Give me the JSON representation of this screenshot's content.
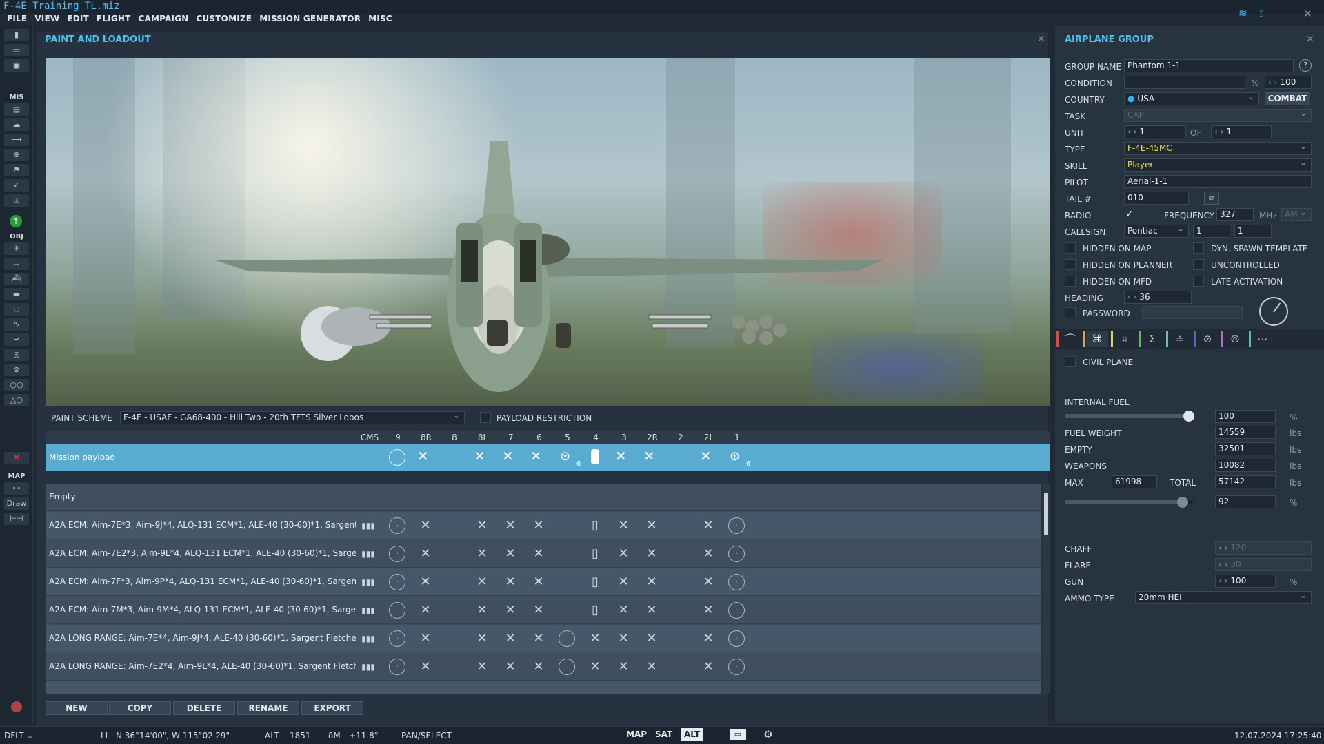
{
  "app": {
    "title": "F-4E Training TL.miz"
  },
  "menu": [
    "FILE",
    "VIEW",
    "EDIT",
    "FLIGHT",
    "CAMPAIGN",
    "CUSTOMIZE",
    "MISSION GENERATOR",
    "MISC"
  ],
  "left_toolbar": {
    "mis_label": "MIS",
    "obj_label": "OBJ",
    "map_label": "MAP",
    "draw_label": "Draw"
  },
  "paint": {
    "title": "PAINT AND LOADOUT",
    "paint_scheme_label": "PAINT SCHEME",
    "paint_scheme_value": "F-4E - USAF - GA68-400 - Hill Two - 20th TFTS Silver Lobos",
    "payload_restriction_label": "PAYLOAD RESTRICTION",
    "columns": [
      "CMS",
      "9",
      "8R",
      "8",
      "8L",
      "7",
      "6",
      "5",
      "4",
      "3",
      "2R",
      "2",
      "2L",
      "1"
    ],
    "mission_payload_label": "Mission payload",
    "mission_payload_counts": {
      "pylon5": "6",
      "pylon1": "6"
    },
    "loadouts": [
      "Empty",
      "A2A ECM: Aim-7E*3, Aim-9J*4, ALQ-131 ECM*1, ALE-40 (30-60)*1, Sargent Fletcher",
      "A2A ECM: Aim-7E2*3, Aim-9L*4, ALQ-131 ECM*1, ALE-40 (30-60)*1, Sargent Fletch",
      "A2A ECM: Aim-7F*3, Aim-9P*4, ALQ-131 ECM*1, ALE-40 (30-60)*1, Sargent Fletche",
      "A2A ECM: Aim-7M*3, Aim-9M*4, ALQ-131 ECM*1, ALE-40 (30-60)*1, Sargent Fletch",
      "A2A LONG RANGE: Aim-7E*4, Aim-9J*4, ALE-40 (30-60)*1, Sargent Fletcher Fuel Ta",
      "A2A LONG RANGE: Aim-7E2*4, Aim-9L*4, ALE-40 (30-60)*1, Sargent Fletcher Fuel T"
    ],
    "buttons": {
      "new": "NEW",
      "copy": "COPY",
      "delete": "DELETE",
      "rename": "RENAME",
      "export": "EXPORT"
    }
  },
  "group": {
    "title": "AIRPLANE GROUP",
    "labels": {
      "group_name": "GROUP NAME",
      "condition": "CONDITION",
      "country": "COUNTRY",
      "task": "TASK",
      "unit": "UNIT",
      "of": "OF",
      "type": "TYPE",
      "skill": "SKILL",
      "pilot": "PILOT",
      "tail": "TAIL #",
      "radio": "RADIO",
      "frequency": "FREQUENCY",
      "callsign": "CALLSIGN",
      "hidden_on_map": "HIDDEN ON MAP",
      "hidden_on_planner": "HIDDEN ON PLANNER",
      "hidden_on_mfd": "HIDDEN ON MFD",
      "dyn_spawn": "DYN. SPAWN TEMPLATE",
      "uncontrolled": "UNCONTROLLED",
      "late_activation": "LATE ACTIVATION",
      "heading": "HEADING",
      "password": "PASSWORD",
      "civil_plane": "CIVIL PLANE"
    },
    "group_name": "Phantom 1-1",
    "condition_pct": "%",
    "condition_value": "100",
    "country": "USA",
    "combat_button": "COMBAT",
    "task": "CAP",
    "unit": "1",
    "unit_of": "1",
    "type": "F-4E-45MC",
    "skill": "Player",
    "pilot": "Aerial-1-1",
    "tail": "010",
    "frequency": "327",
    "freq_unit": "MHz",
    "modulation": "AM",
    "callsign_name": "Pontiac",
    "callsign_1": "1",
    "callsign_2": "1",
    "heading": "36",
    "help": "?"
  },
  "fuel": {
    "labels": {
      "internal_fuel": "INTERNAL FUEL",
      "fuel_weight": "FUEL WEIGHT",
      "empty": "EMPTY",
      "weapons": "WEAPONS",
      "max": "MAX",
      "total": "TOTAL",
      "chaff": "CHAFF",
      "flare": "FLARE",
      "gun": "GUN",
      "ammo_type": "AMMO TYPE"
    },
    "internal_fuel": "100",
    "internal_fuel_level": 0.97,
    "fuel_weight": "14559",
    "empty": "32501",
    "weapons": "10082",
    "max": "61998",
    "total": "57142",
    "total_pct": "92",
    "total_level": 0.92,
    "chaff": "120",
    "flare": "30",
    "gun": "100",
    "ammo_type": "20mm HEI",
    "pct": "%",
    "lbs": "lbs"
  },
  "status": {
    "mode": "DFLT",
    "ll_label": "LL",
    "coords": "N 36°14'00\", W 115°02'29\"",
    "alt_label": "ALT",
    "alt": "1851",
    "dm_label": "δM",
    "dm": "+11.8°",
    "tool": "PAN/SELECT",
    "map_btn": "MAP",
    "sat_btn": "SAT",
    "alt_btn": "ALT",
    "datetime": "12.07.2024 17:25:40"
  },
  "colors": {
    "accent": "#4fc0ea",
    "selected_row": "#5aabd0",
    "type_yellow": "#f0e04a"
  }
}
